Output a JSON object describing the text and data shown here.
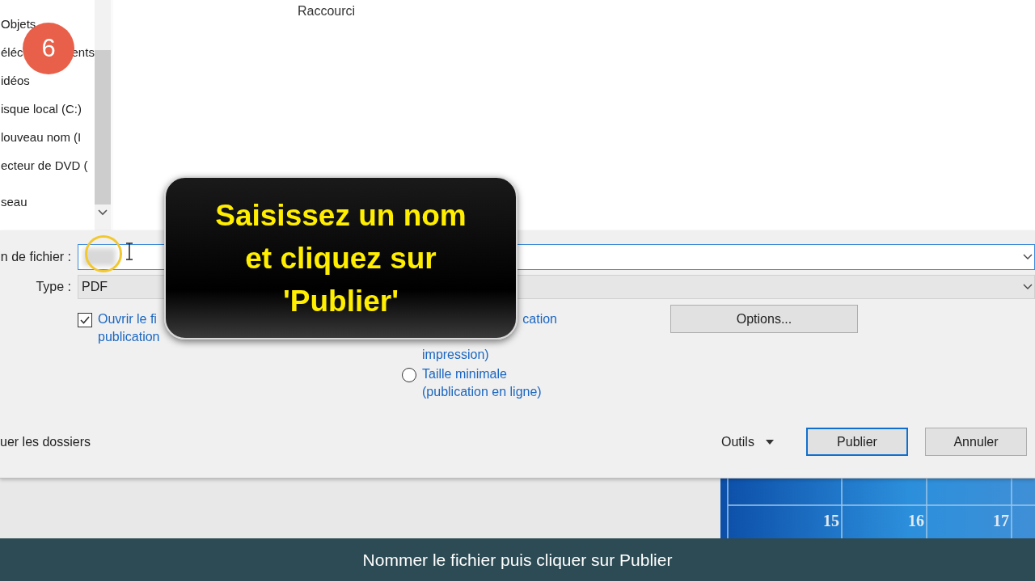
{
  "nav_pane": {
    "items": [
      {
        "text": "Objets"
      },
      {
        "text": "éléc",
        "after": "ents"
      },
      {
        "text": "idéos"
      },
      {
        "text": "isque local (C:)"
      },
      {
        "text": "louveau nom (I"
      },
      {
        "text": "ecteur de DVD ("
      },
      {
        "text": "seau",
        "group_start": true
      }
    ]
  },
  "file_list": {
    "rows": [
      {
        "type": "Raccourci"
      }
    ]
  },
  "form": {
    "file_name": {
      "label": "n de fichier :"
    },
    "type": {
      "label": "Type :",
      "value": "PDF"
    },
    "open_after": {
      "label": "Ouvrir le fi\npublication",
      "checked": true
    },
    "covered_option_text": {
      "lines": [
        "cation",
        "impression)"
      ]
    },
    "radio_options": [
      {
        "label": "Taille minimale\n(publication en ligne)",
        "selected": false
      }
    ],
    "options_button": "Options...",
    "hide_folders": "uer les dossiers",
    "tools": "Outils",
    "publish_button": "Publier",
    "cancel_button": "Annuler"
  },
  "calendar": {
    "days": [
      "15",
      "16",
      "17"
    ]
  },
  "step_badge": "6",
  "callout": "Saisissez un nom\net cliquez sur\n'Publier'",
  "caption": "Nommer le fichier puis cliquer sur Publier"
}
